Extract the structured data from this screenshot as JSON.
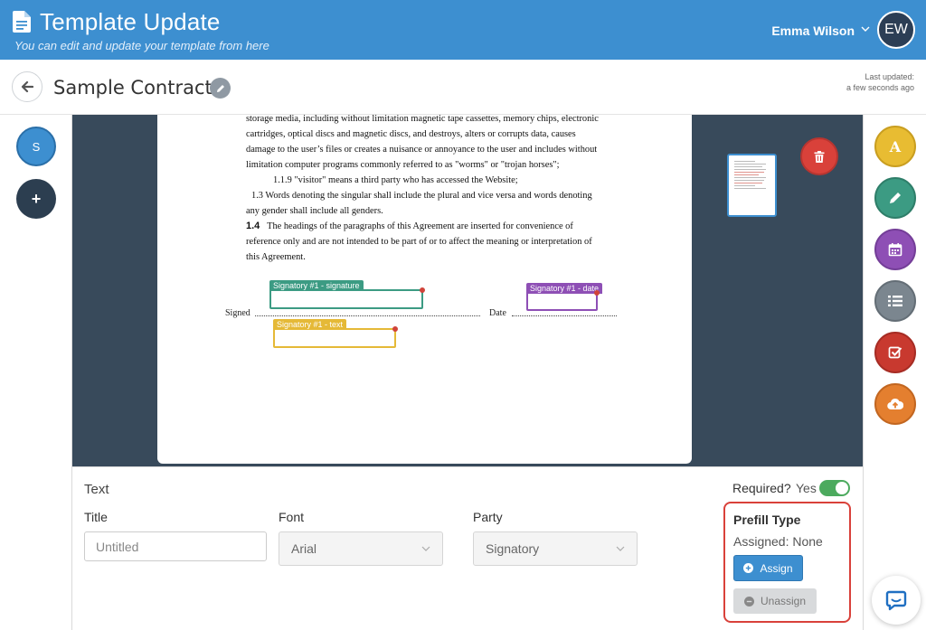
{
  "header": {
    "title": "Template Update",
    "subtitle": "You can edit and update your template from here",
    "user_name": "Emma Wilson",
    "avatar_initials": "EW"
  },
  "subheader": {
    "document_name": "Sample Contract",
    "last_updated_label": "Last updated:",
    "last_updated_value": "a few seconds ago"
  },
  "left_rail": {
    "signer_initial": "S",
    "add_symbol": "+"
  },
  "document": {
    "lines": [
      "storage media, including without limitation magnetic tape cassettes, memory chips, electronic",
      "cartridges, optical discs and magnetic discs, and destroys, alters or corrupts data, causes",
      "damage to the user’s files or creates a nuisance or annoyance to the user and includes without",
      "limitation computer programs commonly referred to as \"worms\" or \"trojan horses\";",
      "1.1.9 \"visitor\" means a third party who has accessed the Website;",
      "1.3 Words denoting the singular shall include the plural and vice versa and words denoting",
      "any gender shall include all genders.",
      "1.4",
      "The headings of the paragraphs of this Agreement are inserted for convenience of",
      "reference only and are not intended to be part of or to affect the meaning or interpretation of",
      "this Agreement."
    ],
    "signed_label": "Signed",
    "date_label": "Date",
    "fields": {
      "signature": "Signatory #1 - signature",
      "date": "Signatory #1 - date",
      "text": "Signatory #1 - text"
    }
  },
  "right_rail": {
    "text_tool_label": "A",
    "tools": [
      "text-tool",
      "signature-tool",
      "date-tool",
      "list-tool",
      "checkbox-tool",
      "upload-tool"
    ]
  },
  "panel": {
    "field_type": "Text",
    "required_label": "Required?",
    "required_value": "Yes",
    "title_label": "Title",
    "title_placeholder": "Untitled",
    "font_label": "Font",
    "font_value": "Arial",
    "party_label": "Party",
    "party_value": "Signatory",
    "prefill": {
      "title": "Prefill Type",
      "assigned": "Assigned: None",
      "assign_label": "Assign",
      "unassign_label": "Unassign"
    }
  },
  "colors": {
    "brand_blue": "#3d8fd0",
    "signature_green": "#3c9b83",
    "date_purple": "#8e4fb5",
    "text_yellow": "#e5b937",
    "danger_red": "#d9413a"
  }
}
